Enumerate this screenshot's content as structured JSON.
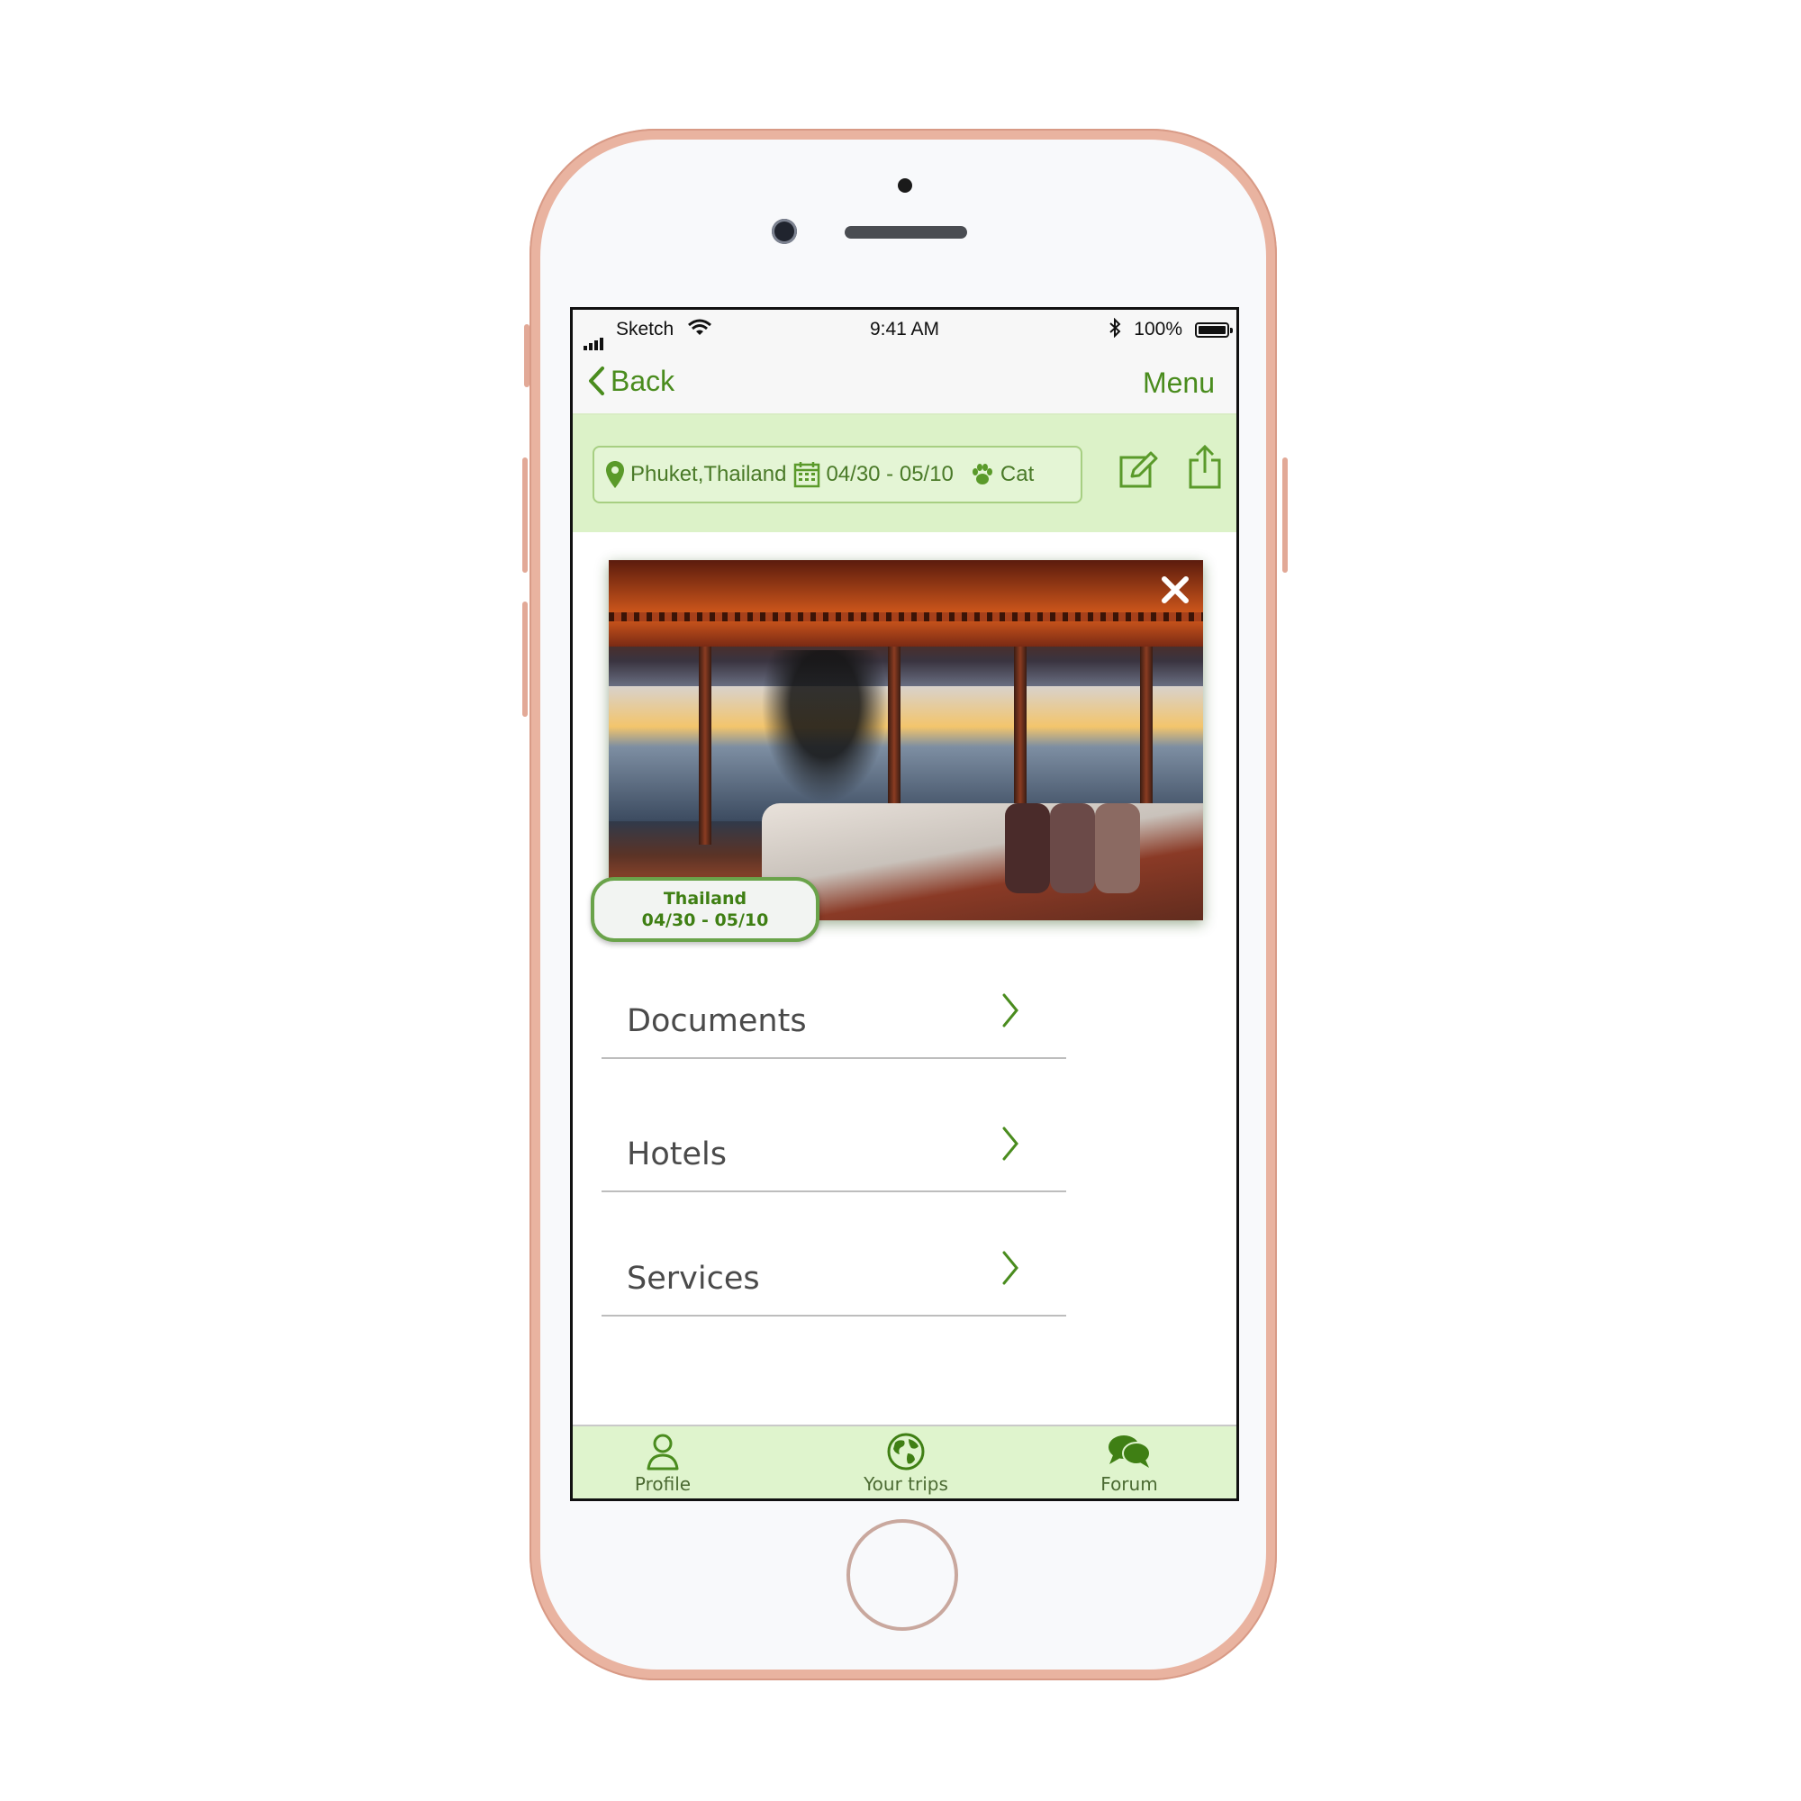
{
  "status_bar": {
    "carrier": "Sketch",
    "time": "9:41 AM",
    "battery": "100%"
  },
  "nav": {
    "back_label": "Back",
    "menu_label": "Menu"
  },
  "trip": {
    "location": "Phuket,Thailand",
    "dates": "04/30 - 05/10",
    "pet": "Cat"
  },
  "photo_card": {
    "title": "Thailand",
    "dates": "04/30 - 05/10"
  },
  "sections": [
    {
      "label": "Documents"
    },
    {
      "label": "Hotels"
    },
    {
      "label": "Services"
    }
  ],
  "tabs": [
    {
      "label": "Profile",
      "icon": "person-icon"
    },
    {
      "label": "Your trips",
      "icon": "globe-icon"
    },
    {
      "label": "Forum",
      "icon": "chat-bubbles-icon"
    }
  ],
  "colors": {
    "accent": "#4a8c1e",
    "tint": "#dcf2c8",
    "phone_frame": "#e9b3a0"
  }
}
